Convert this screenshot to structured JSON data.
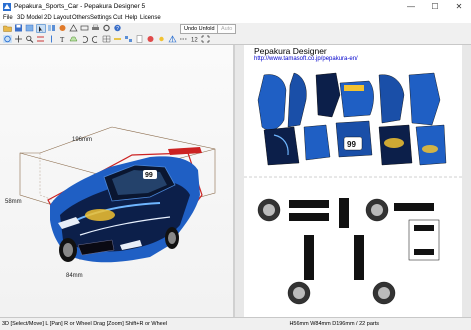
{
  "window": {
    "title": "Pepakura_Sports_Car - Pepakura Designer 5",
    "controls": [
      "—",
      "☐",
      "✕"
    ]
  },
  "menu": [
    "File",
    "3D Model",
    "2D Layout",
    "Others",
    "Settings",
    "Cut",
    "Help",
    "License"
  ],
  "toolbar": {
    "unfold_label": "Undo Unfold",
    "auto_label": "Auto"
  },
  "view3d": {
    "dimensions": {
      "width": "196mm",
      "height": "58mm",
      "depth": "84mm"
    },
    "car_number": "99"
  },
  "view2d": {
    "title": "Pepakura Designer",
    "url": "http://www.tamasoft.co.jp/pepakura-en/",
    "part_number": "99"
  },
  "status": {
    "left": "3D [Select/Move] L [Pan] R or Wheel Drag [Zoom] Shift+R or Wheel",
    "right": "H56mm W84mm D196mm / 22 parts"
  },
  "colors": {
    "car_blue": "#1f5fc4",
    "car_dark": "#0c1f4a",
    "accent_red": "#cc2222"
  }
}
